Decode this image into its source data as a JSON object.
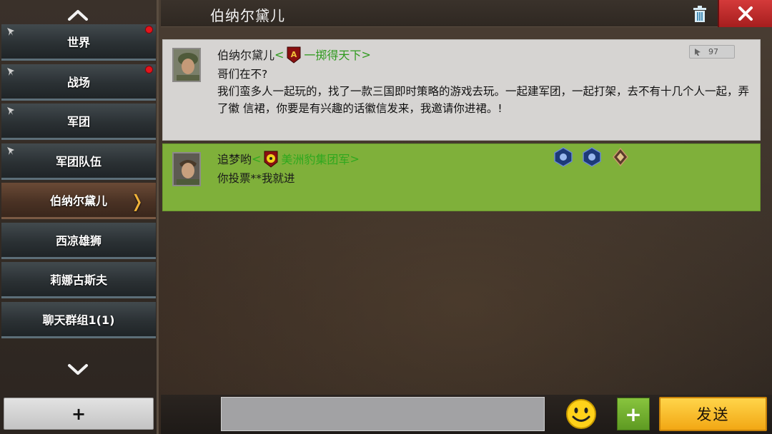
{
  "sidebar": {
    "items": [
      {
        "label": "世界",
        "pinned": true,
        "unread": true
      },
      {
        "label": "战场",
        "pinned": true,
        "unread": true
      },
      {
        "label": "军团",
        "pinned": true,
        "unread": false
      },
      {
        "label": "军团队伍",
        "pinned": true,
        "unread": false
      },
      {
        "label": "伯纳尔黛儿",
        "pinned": false,
        "unread": false,
        "active": true
      },
      {
        "label": "西凉雄狮",
        "pinned": false,
        "unread": false
      },
      {
        "label": "莉娜古斯夫",
        "pinned": false,
        "unread": false
      },
      {
        "label": "聊天群组1(1)",
        "pinned": false,
        "unread": false
      }
    ],
    "add_label": "+",
    "active_chevron": "❭"
  },
  "header": {
    "title": "伯纳尔黛儿"
  },
  "messages": [
    {
      "sender": "伯纳尔黛儿",
      "guild_open": "<",
      "guild": "一掷得天下",
      "guild_close": ">",
      "likes": "97",
      "lines": [
        "哥们在不?",
        "我们蛮多人一起玩的，找了一款三国即时策略的游戏去玩。一起建军团，一起打架，去不有十几个人一起，弄了徽 信裙，你要是有兴趣的话徽信发来，我邀请你进裙。!"
      ]
    },
    {
      "sender": "追梦哟",
      "guild_open": "<",
      "guild": "美洲豹集团军",
      "guild_close": ">",
      "lines": [
        "你投票**我就进"
      ]
    }
  ],
  "input": {
    "value": "",
    "plus_label": "+",
    "send_label": "发送"
  },
  "colors": {
    "message_other": "#d6d4d2",
    "message_highlight": "#7fb03a",
    "guild_name": "#2f9a1e",
    "send_button": "#f2a714",
    "close_button": "#c23030",
    "unread_dot": "#e4141c"
  }
}
